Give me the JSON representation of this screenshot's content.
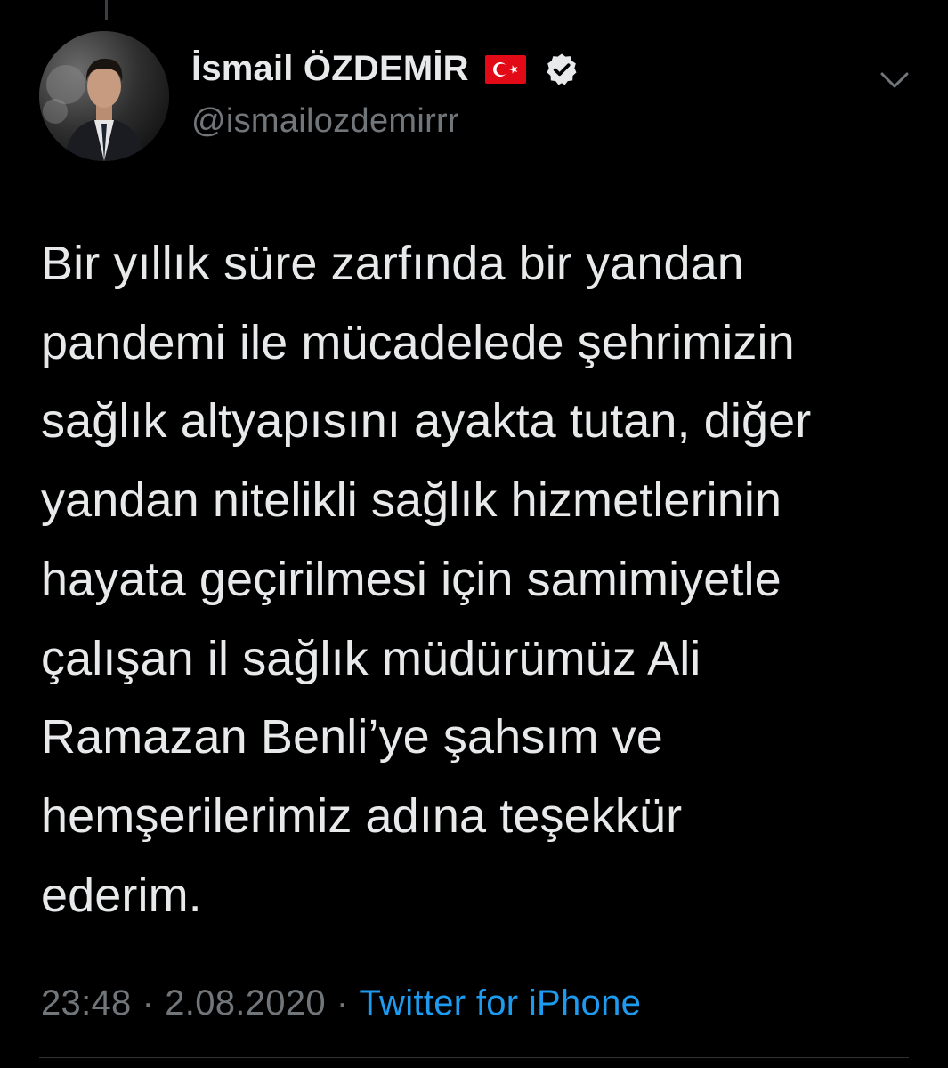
{
  "tweet": {
    "author": {
      "display_name": "İsmail ÖZDEMİR",
      "handle": "@ismailozdemirrr",
      "flag_icon": "turkey-flag-icon",
      "verified_icon": "verified-badge-icon",
      "verified_color": "#e7e9ea"
    },
    "menu_icon": "chevron-down-icon",
    "text": "Bir yıllık süre zarfında bir yandan\npandemi ile mücadelede şehrimizin\nsağlık altyapısını ayakta tutan, diğer\nyandan nitelikli sağlık hizmetlerinin\nhayata geçirilmesi için samimiyetle\nçalışan il sağlık müdürümüz Ali\nRamazan Benli’ye şahsım ve\nhemşerilerimiz adına teşekkür\nederim.",
    "time": "23:48",
    "separator": "·",
    "date": "2.08.2020",
    "source": "Twitter for iPhone"
  },
  "colors": {
    "background": "#000000",
    "text": "#e7e9ea",
    "muted": "#71767b",
    "link": "#1d9bf0",
    "flag_red": "#e30a17"
  }
}
